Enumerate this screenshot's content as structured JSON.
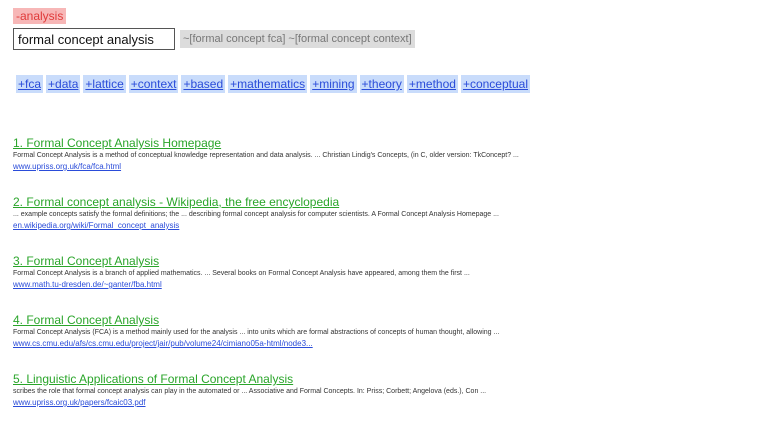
{
  "excluded_term": "-analysis",
  "search": {
    "value": "formal concept analysis"
  },
  "alt_queries": [
    "~[formal concept fca]",
    "~[formal concept context]"
  ],
  "related_terms": [
    "+fca",
    "+data",
    "+lattice",
    "+context",
    "+based",
    "+mathematics",
    "+mining",
    "+theory",
    "+method",
    "+conceptual"
  ],
  "results": [
    {
      "title": "1. Formal Concept Analysis Homepage",
      "snippet": "Formal Concept Analysis is a method of conceptual knowledge representation and data analysis. ... Christian Lindig's Concepts, (in C, older version: TkConcept? ...",
      "url": "www.upriss.org.uk/fca/fca.html"
    },
    {
      "title": "2. Formal concept analysis - Wikipedia, the free encyclopedia",
      "snippet": "... example concepts satisfy the formal definitions; the ... describing formal concept analysis for computer scientists. A Formal Concept Analysis Homepage ...",
      "url": "en.wikipedia.org/wiki/Formal_concept_analysis"
    },
    {
      "title": "3. Formal Concept Analysis",
      "snippet": "Formal Concept Analysis is a branch of applied mathematics. ... Several books on Formal Concept Analysis have appeared, among them the first ...",
      "url": "www.math.tu-dresden.de/~ganter/fba.html"
    },
    {
      "title": "4. Formal Concept Analysis",
      "snippet": "Formal Concept Analysis (FCA) is a method mainly used for the analysis ... into units which are formal abstractions of concepts of human thought, allowing ...",
      "url": "www.cs.cmu.edu/afs/cs.cmu.edu/project/jair/pub/volume24/cimiano05a-html/node3..."
    },
    {
      "title": "5. Linguistic Applications of Formal Concept Analysis",
      "snippet": "scribes the role that formal concept analysis can play in the automated or ... Associative and Formal Concepts. In: Priss; Corbett; Angelova (eds.), Con ...",
      "url": "www.upriss.org.uk/papers/fcaic03.pdf"
    }
  ]
}
